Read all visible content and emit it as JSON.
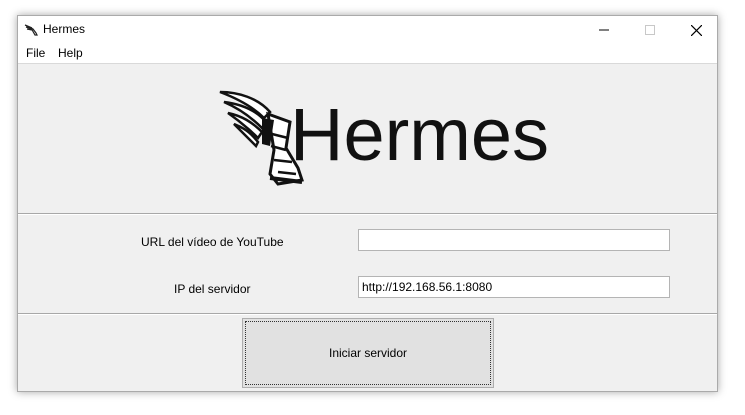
{
  "window": {
    "title": "Hermes",
    "icon": "winged-shoe-icon",
    "controls": [
      "minimize-icon",
      "maximize-icon",
      "close-icon"
    ]
  },
  "menu": {
    "file": "File",
    "help": "Help"
  },
  "logo": {
    "wordmark": "Hermes",
    "icon": "winged-sandal-icon"
  },
  "form": {
    "url_label": "URL del vídeo de YouTube",
    "url_value": "",
    "ip_label": "IP del servidor",
    "ip_value": "http://192.168.56.1:8080"
  },
  "actions": {
    "start_label": "Iniciar servidor"
  }
}
